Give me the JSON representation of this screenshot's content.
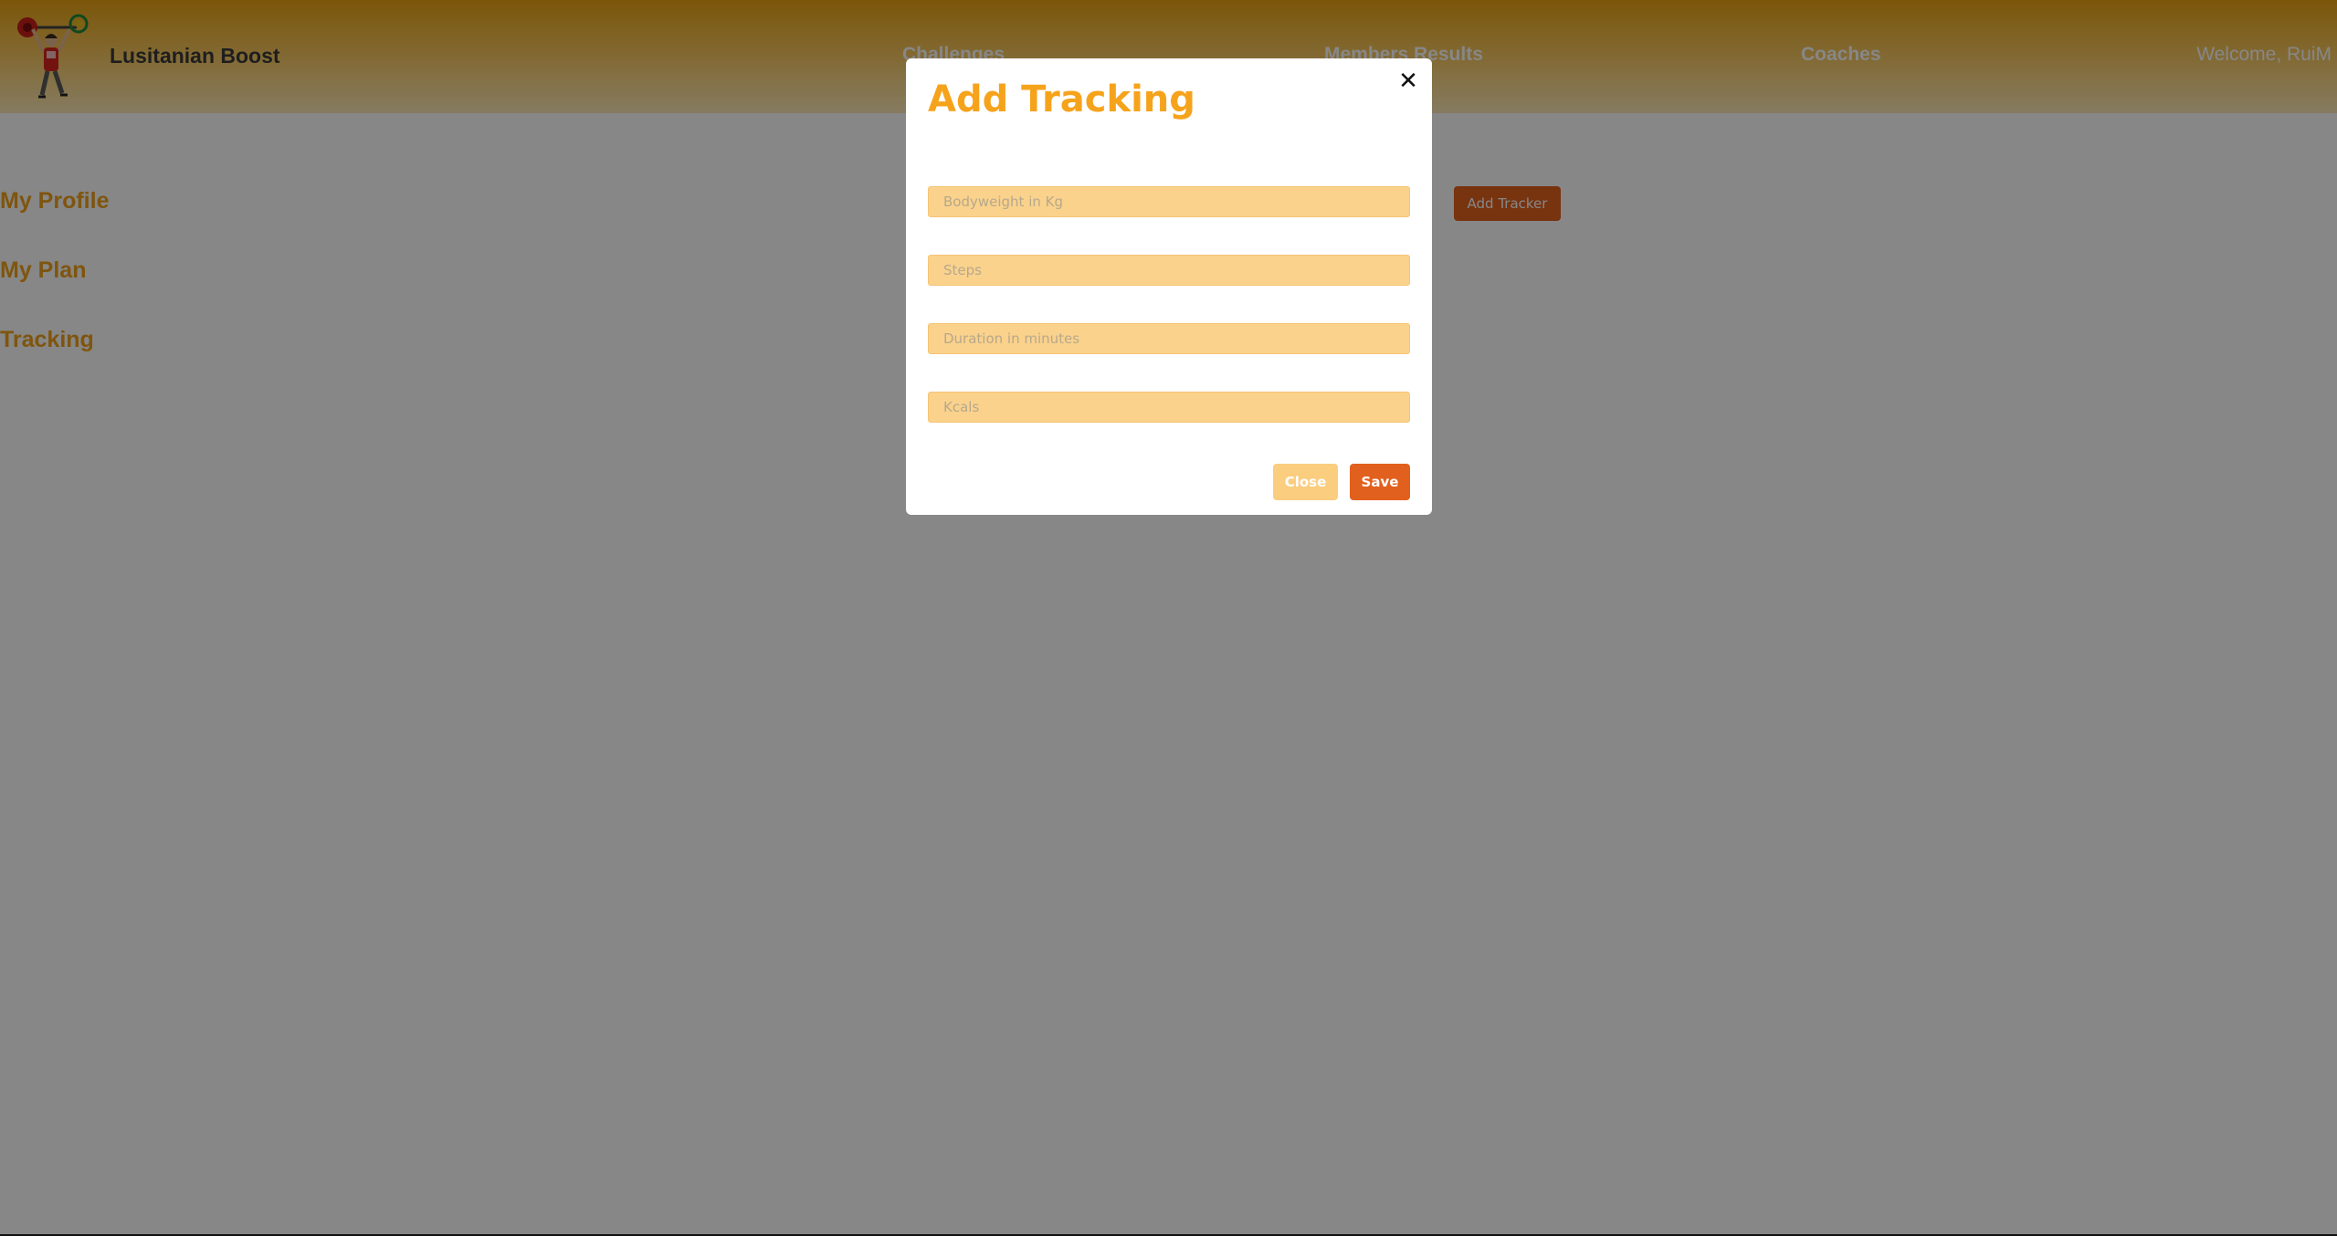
{
  "header": {
    "brand": "Lusitanian Boost",
    "nav": {
      "challenges": "Challenges",
      "members_results": "Members Results",
      "coaches": "Coaches"
    },
    "welcome": "Welcome, RuiM"
  },
  "sidebar": {
    "items": [
      {
        "label": "My Profile"
      },
      {
        "label": "My Plan"
      },
      {
        "label": "Tracking"
      }
    ]
  },
  "main": {
    "add_tracker_label": "Add Tracker"
  },
  "modal": {
    "title": "Add Tracking",
    "close_icon": "close-icon",
    "fields": [
      {
        "placeholder": "Bodyweight in Kg",
        "value": ""
      },
      {
        "placeholder": "Steps",
        "value": ""
      },
      {
        "placeholder": "Duration in minutes",
        "value": ""
      },
      {
        "placeholder": "Kcals",
        "value": ""
      }
    ],
    "close_label": "Close",
    "save_label": "Save"
  },
  "colors": {
    "accent": "#f6a31c",
    "primary_button": "#e2601e",
    "secondary_button": "#fbcd7f",
    "input_background": "#fad28c"
  }
}
